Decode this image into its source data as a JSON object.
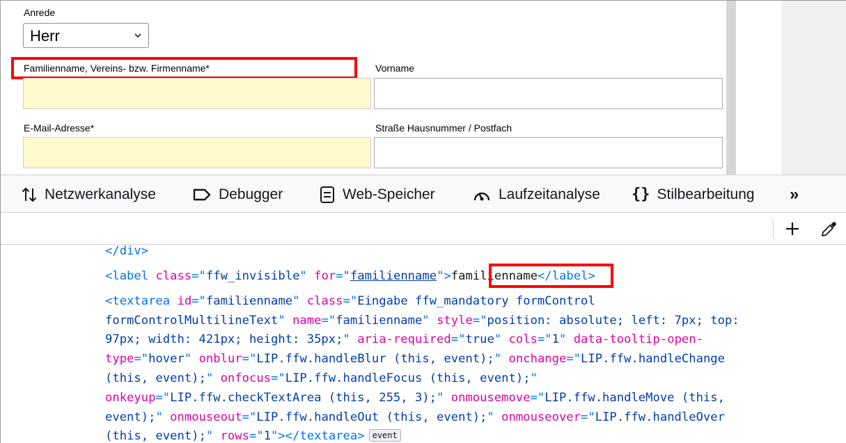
{
  "form": {
    "anrede": {
      "label": "Anrede",
      "value": "Herr"
    },
    "familienname": {
      "label": "Familienname, Vereins- bzw. Firmenname*",
      "value": ""
    },
    "vorname": {
      "label": "Vorname",
      "value": ""
    },
    "email": {
      "label": "E-Mail-Adresse*",
      "value": ""
    },
    "strasse": {
      "label": "Straße Hausnummer / Postfach",
      "value": ""
    },
    "colors": {
      "mandatory_fill": "#fff9cc",
      "highlight_box": "#ff0000"
    }
  },
  "devtools": {
    "tabs": [
      {
        "label": "Netzwerkanalyse",
        "icon": "network-arrows-icon"
      },
      {
        "label": "Debugger",
        "icon": "debugger-icon"
      },
      {
        "label": "Web-Speicher",
        "icon": "storage-icon"
      },
      {
        "label": "Laufzeitanalyse",
        "icon": "performance-gauge-icon"
      },
      {
        "label": "Stilbearbeitung",
        "icon": "braces-icon"
      }
    ],
    "more_tabs": "»",
    "toolbar": {
      "add_node": "+",
      "eyedropper": "eyedropper-icon"
    }
  },
  "markup": {
    "line1": {
      "t1": "</div>"
    },
    "line2": {
      "open": "<label",
      "attr1": " class",
      "eq1": "=\"",
      "val1": "ffw_invisible",
      "q1": "\"",
      "attr2": " for",
      "eq2": "=\"",
      "val2": "familienname",
      "q2": "\"",
      "close": ">",
      "text": "familienname",
      "end_open": "</",
      "end_name": "label",
      "end_close": ">"
    },
    "line3": {
      "open": "<textarea",
      "attr1": " id",
      "eq1": "=\"",
      "val1": "familienname",
      "q1": "\"",
      "attr2": " class",
      "eq2": "=\"",
      "val2": "Eingabe ffw_mandatory formControl"
    },
    "line4": {
      "val": "formControlMultilineText",
      "q": "\"",
      "attr1": " name",
      "eq1": "=\"",
      "val1": "familienname",
      "q1": "\"",
      "attr2": " style",
      "eq2": "=\"",
      "val2": "position: absolute; left: 7px; top:"
    },
    "line5": {
      "val": "97px; width: 421px; height: 35px;",
      "q": "\"",
      "attr1": " aria-required",
      "eq1": "=\"",
      "val1": "true",
      "q1": "\"",
      "attr2": " cols",
      "eq2": "=\"",
      "val2": "1",
      "q2": "\"",
      "attr3": " data-tooltip-open-"
    },
    "line6": {
      "attr": "type",
      "eq": "=\"",
      "val": "hover",
      "q": "\"",
      "attr1": " onblur",
      "eq1": "=\"",
      "val1": "LIP.ffw.handleBlur (this, event);",
      "q1": "\"",
      "attr2": " onchange",
      "eq2": "=\"",
      "val2": "LIP.ffw.handleChange"
    },
    "line7": {
      "val": "(this, event);",
      "q": "\"",
      "attr1": " onfocus",
      "eq1": "=\"",
      "val1": "LIP.ffw.handleFocus (this, event);",
      "q1": "\""
    },
    "line8": {
      "attr": "onkeyup",
      "eq": "=\"",
      "val": "LIP.ffw.checkTextArea (this, 255, 3);",
      "q": "\"",
      "attr1": " onmousemove",
      "eq1": "=\"",
      "val1": "LIP.ffw.handleMove (this,"
    },
    "line9": {
      "val": "event);",
      "q": "\"",
      "attr1": " onmouseout",
      "eq1": "=\"",
      "val1": "LIP.ffw.handleOut (this, event);",
      "q1": "\"",
      "attr2": " onmouseover",
      "eq2": "=\"",
      "val2": "LIP.ffw.handleOver"
    },
    "line10": {
      "val": "(this, event);",
      "q": "\"",
      "attr1": " rows",
      "eq1": "=\"",
      "val1": "1",
      "q1": "\"",
      "close": ">",
      "end": "</textarea>",
      "badge": "event"
    }
  }
}
